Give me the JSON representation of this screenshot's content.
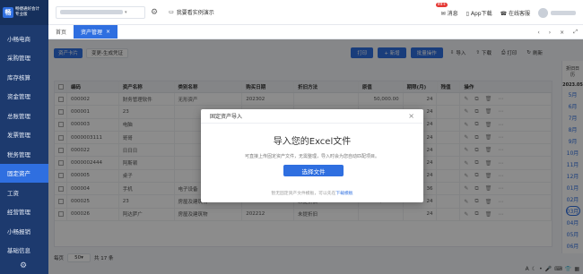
{
  "brand": {
    "name": "畅捷通好会计",
    "edition": "专业版"
  },
  "sidebar": {
    "items": [
      {
        "label": "小畅电商"
      },
      {
        "label": "采购管理"
      },
      {
        "label": "库存核算"
      },
      {
        "label": "资金管理"
      },
      {
        "label": "总账管理"
      },
      {
        "label": "发票管理"
      },
      {
        "label": "税务管理"
      },
      {
        "label": "固定资产"
      },
      {
        "label": "工资"
      },
      {
        "label": "经营管理"
      },
      {
        "label": "小畅报销"
      },
      {
        "label": "基础信息"
      }
    ],
    "active_index": 7
  },
  "header": {
    "demo_label": "我要看实例演示",
    "msg_label": "消息",
    "msg_badge": "99+",
    "app_label": "App下载",
    "service_label": "在线客服"
  },
  "tabs": [
    {
      "label": "首页"
    },
    {
      "label": "资产管理"
    }
  ],
  "filter": {
    "btn1": "资产卡片",
    "btn2": "变更-生成凭证"
  },
  "tools": {
    "print": "打印",
    "add": "+ 新增",
    "batch": "批量操作",
    "import": "导入",
    "export": "下载",
    "print2": "打印",
    "refresh": "刷新"
  },
  "table": {
    "headers": [
      "",
      "编码",
      "资产名称",
      "类别名称",
      "购买日期",
      "折旧方法",
      "原值",
      "期限(月)",
      "残值",
      "操作"
    ],
    "rows": [
      [
        "",
        "000002",
        "财务管理软件",
        "无形资产",
        "202302",
        "",
        "50,000.00",
        "24",
        ""
      ],
      [
        "",
        "000001",
        "23",
        "",
        "202302",
        "",
        "",
        "24",
        ""
      ],
      [
        "",
        "000003",
        "电脑",
        "",
        "",
        "",
        "",
        "24",
        ""
      ],
      [
        "",
        "0000003111",
        "哥哥",
        "",
        "",
        "",
        "",
        "24",
        ""
      ],
      [
        "",
        "000022",
        "日日日",
        "",
        "",
        "",
        "",
        "24",
        ""
      ],
      [
        "",
        "0000002444",
        "阿斯顿",
        "",
        "",
        "",
        "",
        "24",
        ""
      ],
      [
        "",
        "000005",
        "桌子",
        "",
        "",
        "",
        "",
        "24",
        ""
      ],
      [
        "",
        "000004",
        "手机",
        "电子设备",
        "202212",
        "平均年限法",
        "3,600.00",
        "36",
        ""
      ],
      [
        "",
        "000025",
        "23",
        "房屋及建筑物",
        "202212",
        "未提折旧",
        "30,000.00",
        "24",
        ""
      ],
      [
        "",
        "000026",
        "阿达萨广",
        "房屋及建筑物",
        "202212",
        "未提折旧",
        "",
        "24",
        ""
      ]
    ]
  },
  "side_panel": {
    "title_line1": "折旧日",
    "title_line2": "历",
    "year": "2023.05",
    "months": [
      "5月",
      "6月",
      "7月",
      "8月",
      "9月",
      "10月",
      "11月",
      "12月",
      "01月",
      "02月",
      "03月",
      "04月",
      "05月",
      "06月"
    ],
    "current_month_index": 10
  },
  "pager": {
    "label": "每页",
    "size": "50",
    "total": "共 17 条"
  },
  "modal": {
    "header": "固定资产导入",
    "title": "导入您的Excel文件",
    "description": "可直接上传固定资产文件，无需整理，导入时会为您自动匹配项目。",
    "button": "选择文件",
    "tip_prefix": "暂无固定资产文件模板，可以先在",
    "tip_link": "下载模板"
  }
}
